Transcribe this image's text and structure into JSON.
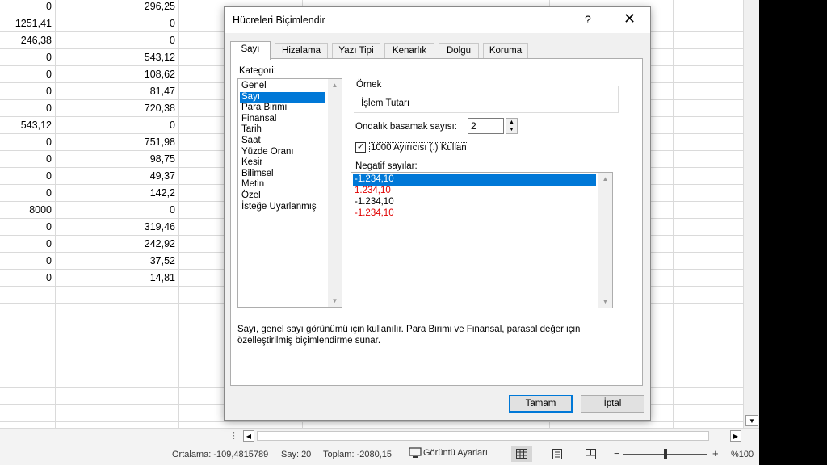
{
  "sheet": {
    "rows": [
      {
        "a": "0",
        "b": "296,25"
      },
      {
        "a": "1251,41",
        "b": "0"
      },
      {
        "a": "246,38",
        "b": "0"
      },
      {
        "a": "0",
        "b": "543,12"
      },
      {
        "a": "0",
        "b": "108,62"
      },
      {
        "a": "0",
        "b": "81,47"
      },
      {
        "a": "0",
        "b": "720,38"
      },
      {
        "a": "543,12",
        "b": "0"
      },
      {
        "a": "0",
        "b": "751,98"
      },
      {
        "a": "0",
        "b": "98,75"
      },
      {
        "a": "0",
        "b": "49,37"
      },
      {
        "a": "0",
        "b": "142,2"
      },
      {
        "a": "8000",
        "b": "0"
      },
      {
        "a": "0",
        "b": "319,46"
      },
      {
        "a": "0",
        "b": "242,92"
      },
      {
        "a": "0",
        "b": "37,52"
      },
      {
        "a": "0",
        "b": "14,81"
      }
    ]
  },
  "dialog": {
    "title": "Hücreleri Biçimlendir",
    "help": "?",
    "close": "✕",
    "tabs": [
      "Sayı",
      "Hizalama",
      "Yazı Tipi",
      "Kenarlık",
      "Dolgu",
      "Koruma"
    ],
    "active_tab": "Sayı",
    "category_label": "Kategori:",
    "categories": [
      "Genel",
      "Sayı",
      "Para Birimi",
      "Finansal",
      "Tarih",
      "Saat",
      "Yüzde Oranı",
      "Kesir",
      "Bilimsel",
      "Metin",
      "Özel",
      "İsteğe Uyarlanmış"
    ],
    "selected_category": "Sayı",
    "sample_label": "Örnek",
    "sample_value": "İşlem Tutarı",
    "decimal_label": "Ondalık basamak sayısı:",
    "decimal_value": "2",
    "thousands_label": "1000 Ayırıcısı (.) Kullan",
    "thousands_checked": true,
    "negative_label": "Negatif sayılar:",
    "negative_options": [
      {
        "text": "-1.234,10",
        "color": "#000000",
        "selected": true
      },
      {
        "text": "1.234,10",
        "color": "#e00000",
        "selected": false
      },
      {
        "text": "-1.234,10",
        "color": "#000000",
        "selected": false
      },
      {
        "text": "-1.234,10",
        "color": "#e00000",
        "selected": false
      }
    ],
    "description": "Sayı, genel sayı görünümü için kullanılır. Para Birimi ve Finansal, parasal değer için özelleştirilmiş biçimlendirme sunar.",
    "ok_label": "Tamam",
    "cancel_label": "İptal"
  },
  "statusbar": {
    "average": "Ortalama: -109,4815789",
    "count": "Say: 20",
    "sum": "Toplam: -2080,15",
    "display_settings": "Görüntü Ayarları",
    "zoom_minus": "−",
    "zoom_plus": "+",
    "zoom": "%100"
  },
  "colors": {
    "accent": "#0078d7",
    "negative_red": "#e00000"
  }
}
